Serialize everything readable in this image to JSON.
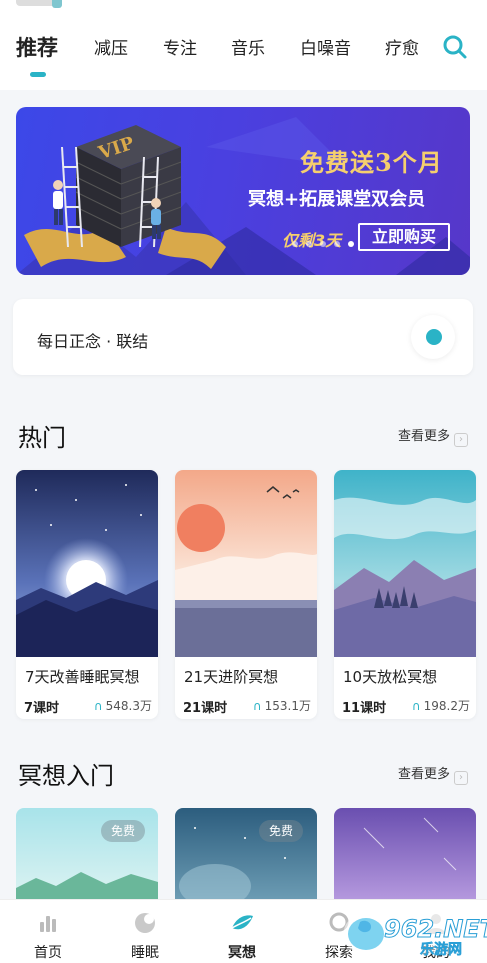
{
  "tabs": [
    {
      "label": "推荐",
      "active": true
    },
    {
      "label": "减压",
      "active": false
    },
    {
      "label": "专注",
      "active": false
    },
    {
      "label": "音乐",
      "active": false
    },
    {
      "label": "白噪音",
      "active": false
    },
    {
      "label": "疗愈",
      "active": false
    }
  ],
  "banner": {
    "title": "免费送3个月",
    "subtitle": "冥想+拓展课堂双会员",
    "countdown": "仅剩3天",
    "cta": "立即购买",
    "badge_text": "VIP"
  },
  "daily": {
    "text": "每日正念 · 联结"
  },
  "popular": {
    "title": "热门",
    "more": "查看更多",
    "cards": [
      {
        "title": "7天改善睡眠冥想",
        "lessons": "7课时",
        "plays": "548.3万"
      },
      {
        "title": "21天进阶冥想",
        "lessons": "21课时",
        "plays": "153.1万"
      },
      {
        "title": "10天放松冥想",
        "lessons": "11课时",
        "plays": "198.2万"
      }
    ]
  },
  "intro": {
    "title": "冥想入门",
    "more": "查看更多",
    "badges": [
      "免费",
      "免费"
    ]
  },
  "bottom_nav": [
    {
      "label": "首页",
      "icon": "home-bars-icon",
      "active": false
    },
    {
      "label": "睡眠",
      "icon": "moon-icon",
      "active": false
    },
    {
      "label": "冥想",
      "icon": "meditation-leaf-icon",
      "active": true
    },
    {
      "label": "探索",
      "icon": "explore-icon",
      "active": false
    },
    {
      "label": "我的",
      "icon": "profile-icon",
      "active": false
    }
  ],
  "watermark": {
    "main": "962.NET",
    "sub": "乐游网"
  },
  "colors": {
    "accent": "#2ab3c6",
    "banner_gold": "#f5cf6e",
    "banner_blue": "#3c48e8"
  }
}
